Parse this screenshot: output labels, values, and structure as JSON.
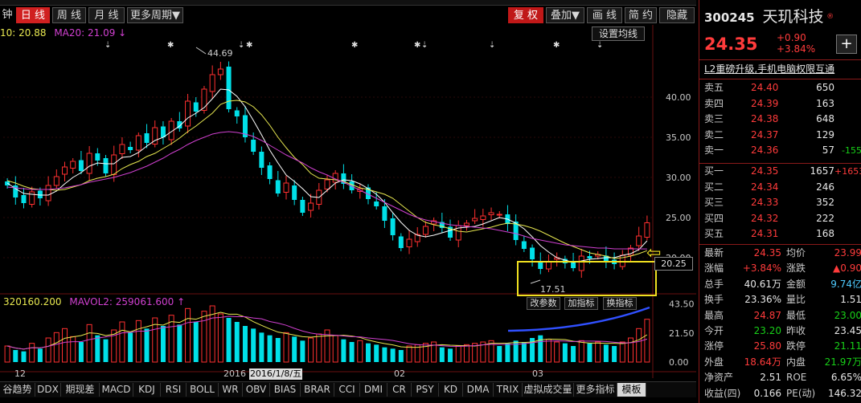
{
  "toolbar": {
    "left_buttons": [
      {
        "label": "钟",
        "active": false
      },
      {
        "label": "日 线",
        "active": true
      },
      {
        "label": "周 线",
        "active": false
      },
      {
        "label": "月 线",
        "active": false
      },
      {
        "label": "更多周期▼",
        "active": false
      }
    ],
    "right_buttons": [
      {
        "label": "复 权",
        "active": true
      },
      {
        "label": "叠加▼",
        "active": false
      },
      {
        "label": "画 线",
        "active": false
      },
      {
        "label": "简 约",
        "active": false
      },
      {
        "label": "隐藏",
        "active": false
      }
    ]
  },
  "main_legend": {
    "ma10": "10: 20.88",
    "ma20": "MA20: 21.09 ↓",
    "ma10_color": "#e8e850",
    "ma20_color": "#d040d0"
  },
  "setting_button": "设置均线",
  "annotations": {
    "high_label": "44.69",
    "low_label": "17.51",
    "current_price_box": "20.25",
    "cursor_date": "2016/1/8/五",
    "arrow": "⇦"
  },
  "overlay_buttons": [
    "改参数",
    "加指标",
    "换指标"
  ],
  "volume_legend": {
    "vol": "320160.200",
    "mavol2": "MAVOL2: 259061.600 ↑"
  },
  "price_axis": [
    "40.00",
    "35.00",
    "30.00",
    "25.00",
    "20.00"
  ],
  "volume_axis": [
    "43.50",
    "21.50",
    "0.00"
  ],
  "date_axis": [
    "12",
    "2016",
    "02",
    "03"
  ],
  "chart_data": {
    "type": "candlestick",
    "title": "",
    "ylim": [
      16,
      47
    ],
    "y_ticks": [
      20,
      25,
      30,
      35,
      40
    ],
    "high": 44.69,
    "low": 17.51,
    "current": 24.35,
    "closes": [
      29,
      27.5,
      26.8,
      28.2,
      27.4,
      29.0,
      30.1,
      31.3,
      32.0,
      30.8,
      33.0,
      32.1,
      30.5,
      32.8,
      34.1,
      33.4,
      35.2,
      34.3,
      36.2,
      35.0,
      37.0,
      36.1,
      39.5,
      38.2,
      41.0,
      42.8,
      43.5,
      38.5,
      37.6,
      35.0,
      33.2,
      31.2,
      29.8,
      28.0,
      29.3,
      27.2,
      25.6,
      26.8,
      28.4,
      29.7,
      30.5,
      29.2,
      28.4,
      28.6,
      27.3,
      26.4,
      24.6,
      22.8,
      21.2,
      22.3,
      22.9,
      23.9,
      24.6,
      23.7,
      22.5,
      24.0,
      24.3,
      24.9,
      25.2,
      25.6,
      25.4,
      24.2,
      22.2,
      21.1,
      19.8,
      18.6,
      19.5,
      20.0,
      19.3,
      18.7,
      20.2,
      19.9,
      20.4,
      19.6,
      19.2,
      20.3,
      21.2,
      22.7,
      24.35
    ],
    "ma5": [
      29.3,
      28.6,
      28.0,
      27.9,
      27.8,
      27.8,
      28.3,
      29.2,
      30.0,
      30.6,
      31.4,
      31.8,
      31.7,
      31.7,
      32.5,
      32.6,
      33.1,
      33.9,
      34.6,
      35.0,
      35.7,
      36.4,
      37.4,
      38.0,
      38.7,
      39.8,
      41.0,
      40.9,
      40.1,
      38.8,
      37.1,
      35.3,
      33.4,
      31.8,
      30.3,
      29.5,
      28.6,
      27.6,
      27.5,
      28.4,
      29.3,
      29.7,
      29.6,
      29.2,
      28.6,
      27.9,
      26.9,
      25.6,
      24.4,
      23.4,
      22.8,
      22.6,
      22.8,
      23.1,
      23.4,
      23.7,
      23.8,
      23.9,
      24.2,
      24.6,
      25.0,
      24.8,
      24.3,
      23.6,
      22.6,
      21.5,
      20.7,
      20.0,
      19.7,
      19.4,
      19.6,
      19.8,
      19.9,
      20.0,
      20.0,
      20.3,
      20.5,
      21.0,
      22.1
    ],
    "ma10": [
      29.6,
      29.3,
      28.9,
      28.6,
      28.5,
      28.5,
      28.4,
      28.5,
      28.8,
      29.1,
      29.6,
      29.9,
      30.1,
      30.4,
      31.1,
      31.6,
      32.0,
      32.6,
      33.0,
      33.6,
      34.2,
      34.9,
      35.7,
      36.4,
      37.2,
      38.0,
      39.1,
      39.5,
      39.6,
      39.4,
      38.8,
      37.8,
      36.5,
      35.0,
      33.7,
      32.5,
      31.6,
      30.5,
      29.9,
      29.8,
      29.7,
      29.5,
      29.1,
      28.7,
      28.5,
      28.2,
      27.9,
      27.4,
      26.6,
      25.8,
      25.0,
      24.4,
      24.1,
      23.9,
      23.6,
      23.3,
      23.2,
      23.4,
      23.6,
      23.8,
      24.1,
      24.3,
      24.2,
      24.0,
      23.7,
      23.3,
      22.8,
      22.3,
      21.8,
      21.4,
      21.0,
      20.6,
      20.4,
      20.2,
      19.9,
      20.0,
      20.2,
      20.5,
      20.88
    ],
    "ma20": [
      28.8,
      28.7,
      28.6,
      28.5,
      28.5,
      28.5,
      28.6,
      28.7,
      28.9,
      29.1,
      29.4,
      29.6,
      29.8,
      30.0,
      30.3,
      30.6,
      31.0,
      31.4,
      31.9,
      32.4,
      33.0,
      33.5,
      34.1,
      34.6,
      35.0,
      35.4,
      35.6,
      35.7,
      35.6,
      35.4,
      35.1,
      34.6,
      34.0,
      33.4,
      32.8,
      32.3,
      31.8,
      31.2,
      30.7,
      30.3,
      29.8,
      29.4,
      28.9,
      28.4,
      27.9,
      27.4,
      26.9,
      26.4,
      25.9,
      25.4,
      25.0,
      24.7,
      24.5,
      24.3,
      24.1,
      24.0,
      23.9,
      23.8,
      23.7,
      23.6,
      23.4,
      23.2,
      23.0,
      22.7,
      22.4,
      22.2,
      22.0,
      21.8,
      21.6,
      21.5,
      21.4,
      21.3,
      21.2,
      21.2,
      21.1,
      21.1,
      21.1,
      21.1,
      21.09
    ],
    "volume": [
      12,
      9,
      8,
      14,
      10,
      18,
      22,
      25,
      19,
      15,
      28,
      20,
      17,
      24,
      30,
      22,
      31,
      25,
      33,
      27,
      35,
      28,
      40,
      30,
      38,
      42,
      36,
      33,
      30,
      27,
      25,
      22,
      20,
      18,
      22,
      19,
      16,
      18,
      21,
      24,
      20,
      17,
      15,
      16,
      14,
      13,
      11,
      10,
      9,
      12,
      13,
      14,
      15,
      11,
      10,
      12,
      13,
      14,
      15,
      16,
      12,
      14,
      16,
      15,
      18,
      20,
      17,
      15,
      14,
      12,
      16,
      14,
      15,
      13,
      12,
      15,
      18,
      25,
      32
    ],
    "volume_ylim": [
      0,
      45
    ]
  },
  "bottom_tabs": [
    "谷趋势",
    "DDX",
    "期现差",
    "MACD",
    "KDJ",
    "RSI",
    "BOLL",
    "WR",
    "OBV",
    "BIAS",
    "BRAR",
    "CCI",
    "DMI",
    "CR",
    "PSY",
    "KD",
    "DMA",
    "TRIX",
    "虚拟成交量",
    "更多指标",
    "模板"
  ],
  "quote": {
    "code": "300245",
    "name": "天玑科技",
    "price": "24.35",
    "change": "+0.90",
    "change_pct": "+3.84%",
    "news": "L2重磅升级,手机电脑权限互通",
    "asks": [
      {
        "label": "卖五",
        "price": "24.40",
        "vol": "650",
        "chg": ""
      },
      {
        "label": "卖四",
        "price": "24.39",
        "vol": "163",
        "chg": ""
      },
      {
        "label": "卖三",
        "price": "24.38",
        "vol": "648",
        "chg": ""
      },
      {
        "label": "卖二",
        "price": "24.37",
        "vol": "129",
        "chg": ""
      },
      {
        "label": "卖一",
        "price": "24.36",
        "vol": "57",
        "chg": "-155"
      }
    ],
    "bids": [
      {
        "label": "买一",
        "price": "24.35",
        "vol": "1657",
        "chg": "+1653"
      },
      {
        "label": "买二",
        "price": "24.34",
        "vol": "246",
        "chg": ""
      },
      {
        "label": "买三",
        "price": "24.33",
        "vol": "352",
        "chg": ""
      },
      {
        "label": "买四",
        "price": "24.32",
        "vol": "222",
        "chg": ""
      },
      {
        "label": "买五",
        "price": "24.31",
        "vol": "168",
        "chg": ""
      }
    ],
    "stats": [
      {
        "l1": "最新",
        "v1": "24.35",
        "c1": "red",
        "l2": "均价",
        "v2": "23.99",
        "c2": "red"
      },
      {
        "l1": "涨幅",
        "v1": "+3.84%",
        "c1": "red",
        "l2": "涨跌",
        "v2": "▲0.90",
        "c2": "red"
      },
      {
        "l1": "总手",
        "v1": "40.61万",
        "c1": "white",
        "l2": "金额",
        "v2": "9.74亿",
        "c2": "cyan"
      },
      {
        "l1": "换手",
        "v1": "23.36%",
        "c1": "white",
        "l2": "量比",
        "v2": "1.51",
        "c2": "white"
      },
      {
        "l1": "最高",
        "v1": "24.87",
        "c1": "red",
        "l2": "最低",
        "v2": "23.00",
        "c2": "green"
      },
      {
        "l1": "今开",
        "v1": "23.20",
        "c1": "green",
        "l2": "昨收",
        "v2": "23.45",
        "c2": "white"
      },
      {
        "l1": "涨停",
        "v1": "25.80",
        "c1": "red",
        "l2": "跌停",
        "v2": "21.11",
        "c2": "green"
      },
      {
        "l1": "外盘",
        "v1": "18.64万",
        "c1": "red",
        "l2": "内盘",
        "v2": "21.97万",
        "c2": "green"
      },
      {
        "l1": "净资产",
        "v1": "2.51",
        "c1": "white",
        "l2": "ROE",
        "v2": "6.65%",
        "c2": "white"
      },
      {
        "l1": "收益(四)",
        "v1": "0.166",
        "c1": "white",
        "l2": "PE(动)",
        "v2": "146.32",
        "c2": "white"
      }
    ],
    "plus": "+"
  }
}
